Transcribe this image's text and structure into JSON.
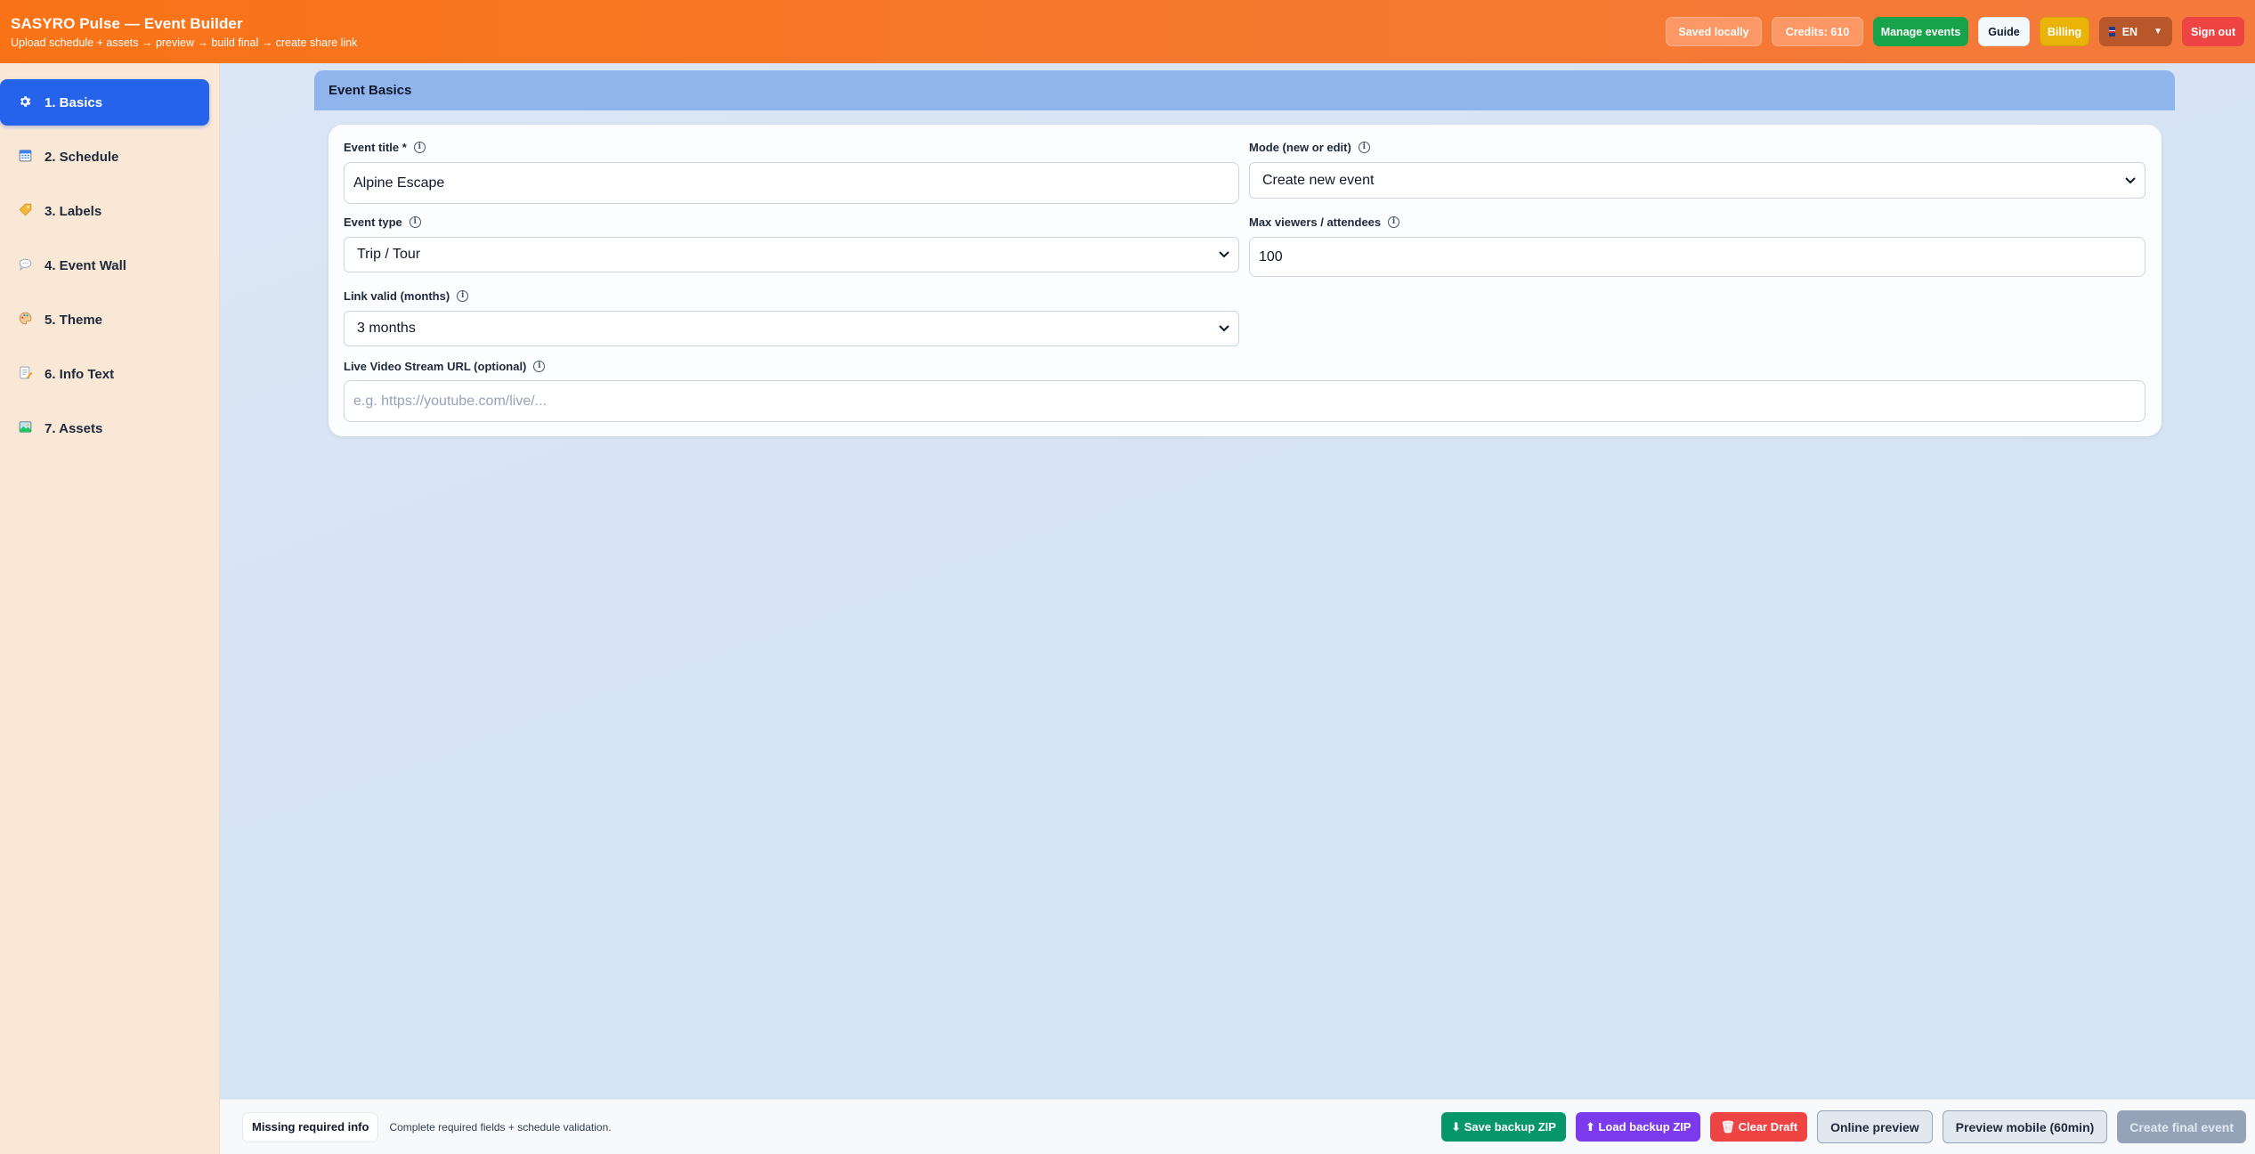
{
  "header": {
    "title": "SASYRO Pulse — Event Builder",
    "subtitle": "Upload schedule + assets → preview → build final → create share link",
    "saved_label": "Saved locally",
    "credits_label": "Credits: 610",
    "manage_label": "Manage events",
    "guide_label": "Guide",
    "billing_label": "Billing",
    "lang_label": "EN",
    "signout_label": "Sign out"
  },
  "sidebar": {
    "items": [
      {
        "label": "1. Basics",
        "icon": "gear-icon",
        "active": true
      },
      {
        "label": "2. Schedule",
        "icon": "calendar-icon",
        "active": false
      },
      {
        "label": "3. Labels",
        "icon": "tag-icon",
        "active": false
      },
      {
        "label": "4. Event Wall",
        "icon": "speech-bubble-icon",
        "active": false
      },
      {
        "label": "5. Theme",
        "icon": "palette-icon",
        "active": false
      },
      {
        "label": "6. Info Text",
        "icon": "memo-icon",
        "active": false
      },
      {
        "label": "7. Assets",
        "icon": "picture-icon",
        "active": false
      }
    ]
  },
  "main": {
    "section_title": "Event Basics",
    "fields": {
      "event_title": {
        "label": "Event title *",
        "value": "Alpine Escape"
      },
      "mode": {
        "label": "Mode (new or edit)",
        "value": "Create new event"
      },
      "event_type": {
        "label": "Event type",
        "value": "Trip / Tour"
      },
      "max_viewers": {
        "label": "Max viewers / attendees",
        "value": "100"
      },
      "link_valid": {
        "label": "Link valid (months)",
        "value": "3 months"
      },
      "stream_url": {
        "label": "Live Video Stream URL (optional)",
        "placeholder": "e.g. https://youtube.com/live/..."
      }
    },
    "info_glyph": "i"
  },
  "footer": {
    "status": "Missing required info",
    "note": "Complete required fields + schedule validation.",
    "save_zip": "⬇ Save backup ZIP",
    "load_zip": "⬆ Load backup ZIP",
    "clear_draft": "🗑 Clear Draft",
    "online_preview": "Online preview",
    "preview_mobile": "Preview mobile (60min)",
    "create_final": "Create final event"
  },
  "colors": {
    "header": "#f97316",
    "sidebar_bg": "#f9e8d5",
    "active_nav": "#2563eb",
    "section_header": "#90b4ec"
  }
}
